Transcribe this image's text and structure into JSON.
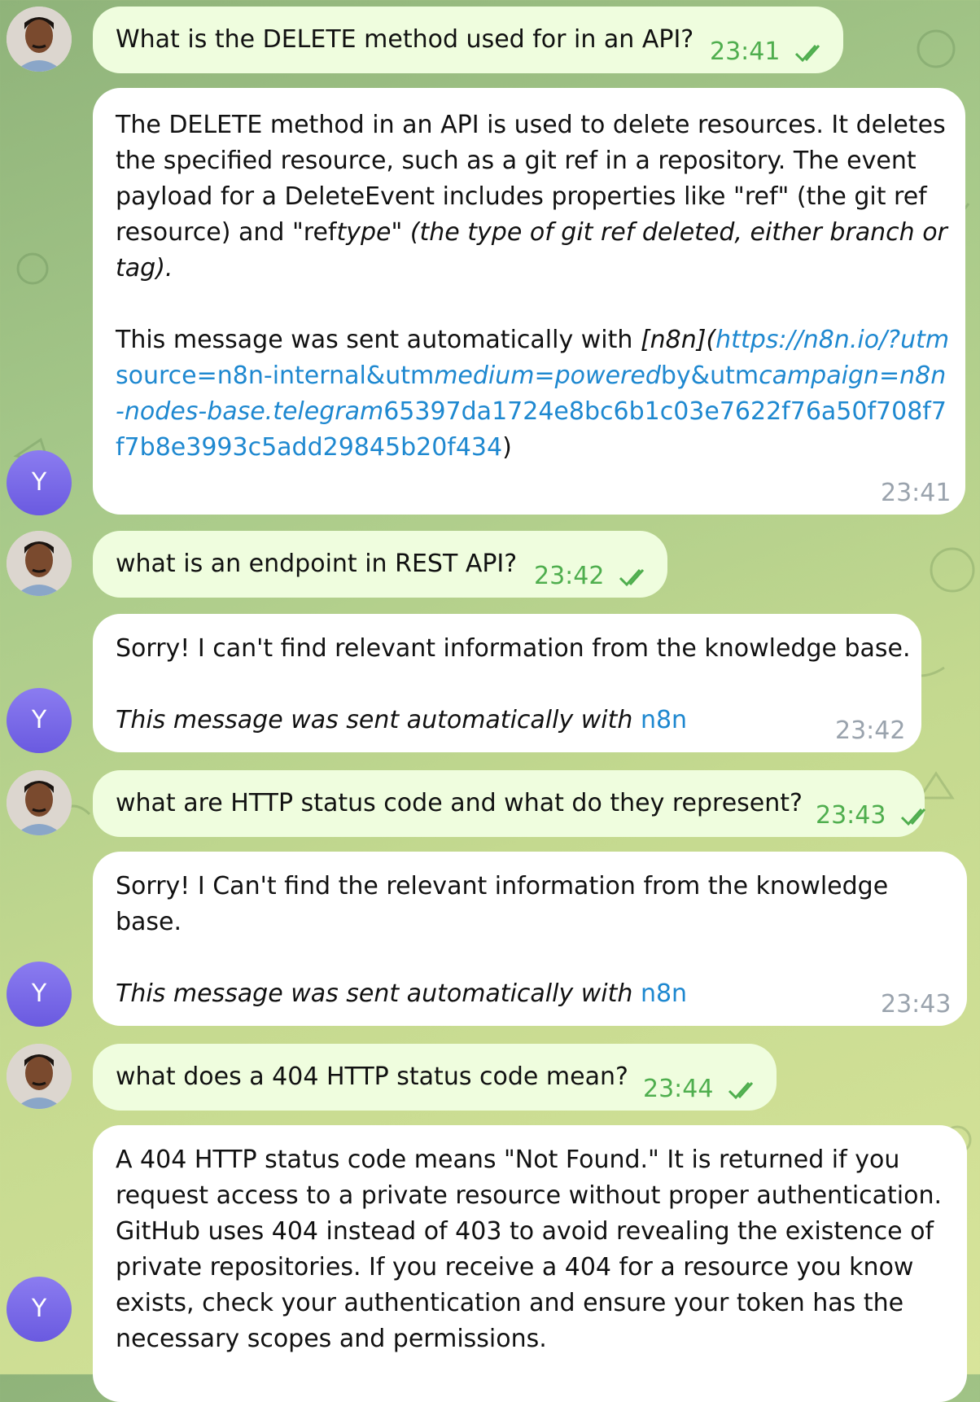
{
  "colors": {
    "outgoing_bubble": "#effdde",
    "incoming_bubble": "#ffffff",
    "time_outgoing": "#4fae4e",
    "time_incoming": "#9aa3ad",
    "link": "#1e88d0",
    "bot_avatar": "#7b6aea"
  },
  "bot_avatar_initial": "Y",
  "messages": [
    {
      "sender": "user",
      "text": "What is the DELETE method used for in an API?",
      "time": "23:41",
      "status": "read"
    },
    {
      "sender": "bot",
      "p1_a": "The DELETE method in an API is used to delete resources. It deletes the specified resource, such as a git ref in a repository. The event payload for a DeleteEvent includes properties like \"ref\" (the git ref resource) and \"ref",
      "p1_b": "type\" (the type of git ref deleted, either branch or tag).",
      "p2_a": "This message was sent automatically with ",
      "p2_b": "[n8n](",
      "p2_c": "https://n8n.io/?",
      "p2_d": "utm",
      "p2_e": "source=n8n-internal&utm",
      "p2_f": "medium=powered",
      "p2_g": "by&utm",
      "p2_h": "campaign=n8n-nodes-base.telegram",
      "p2_i": "65397da1724e8bc6b1c03e7622f76a50f708f7f7b8e3993c5add29845b20f434",
      "p2_j": ")",
      "time": "23:41"
    },
    {
      "sender": "user",
      "text": "what is an endpoint in REST API?",
      "time": "23:42",
      "status": "read"
    },
    {
      "sender": "bot",
      "line1": "Sorry! I can't find relevant information from the knowledge base.",
      "footer": "This message was sent automatically with ",
      "footer_link": "n8n",
      "time": "23:42"
    },
    {
      "sender": "user",
      "text": "what are HTTP status code and what do they represent?",
      "time": "23:43",
      "status": "read"
    },
    {
      "sender": "bot",
      "line1": "Sorry! I Can't find the relevant information from the knowledge base.",
      "footer": "This message was sent automatically with ",
      "footer_link": "n8n",
      "time": "23:43"
    },
    {
      "sender": "user",
      "text": "what does a 404 HTTP status code mean?",
      "time": "23:44",
      "status": "read"
    },
    {
      "sender": "bot",
      "text": "A 404 HTTP status code means \"Not Found.\" It is returned if you request access to a private resource without proper authentication. GitHub uses 404 instead of 403 to avoid revealing the existence of private repositories. If you receive a 404 for a resource you know exists, check your authentication and ensure your token has the necessary scopes and permissions."
    }
  ]
}
